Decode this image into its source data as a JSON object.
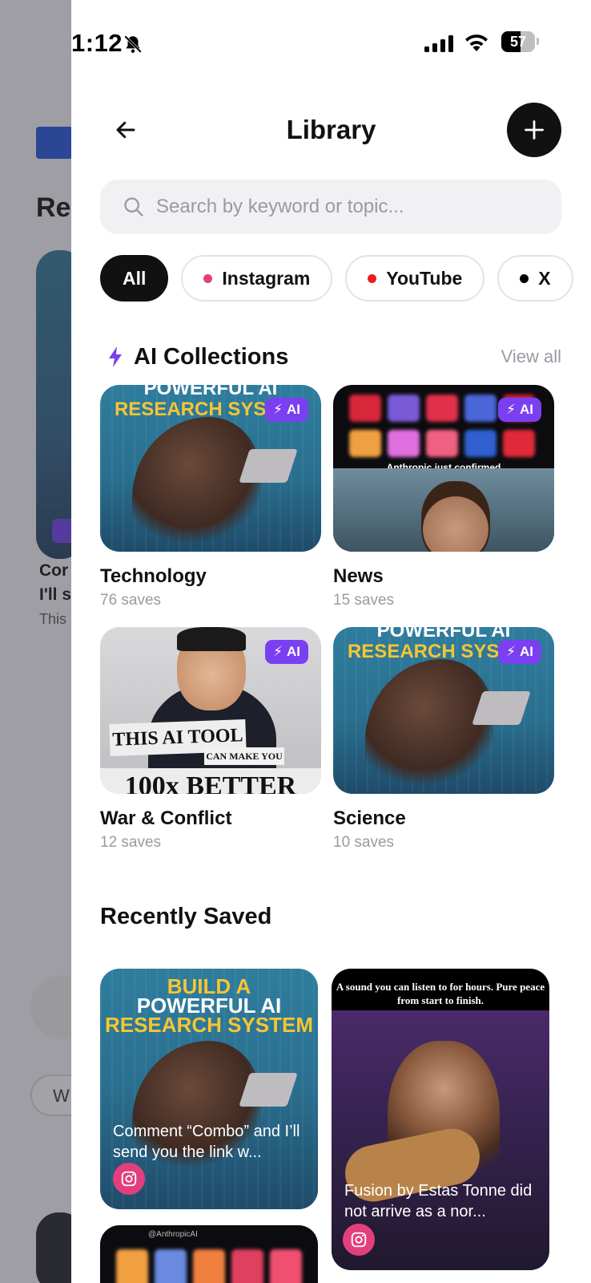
{
  "status_bar": {
    "time": "1:12",
    "battery": "57",
    "battery_level": 0.57
  },
  "background": {
    "title_fragment": "Re",
    "card_text_1": "Cor",
    "card_text_2": "I'll s",
    "card_text_3": "This",
    "pill_text": "W"
  },
  "header": {
    "title": "Library"
  },
  "search": {
    "placeholder": "Search by keyword or topic...",
    "value": ""
  },
  "filters": [
    {
      "label": "All",
      "active": true
    },
    {
      "label": "Instagram",
      "dot_color": "#e23f7d"
    },
    {
      "label": "YouTube",
      "dot_color": "#ee1d1d"
    },
    {
      "label": "X",
      "dot_color": "#000000"
    }
  ],
  "ai_collections": {
    "title": "AI Collections",
    "view_all": "View all",
    "badge": "AI",
    "items": [
      {
        "name": "Technology",
        "count": "76 saves",
        "thumb_text_top": "POWERFUL AI",
        "thumb_text_bottom": "RESEARCH SYSTEM"
      },
      {
        "name": "News",
        "count": "15 saves",
        "thumb_caption": "Anthropic just confirmed"
      },
      {
        "name": "War & Conflict",
        "count": "12 saves",
        "thumb_text_1": "THIS AI TOOL",
        "thumb_text_2": "CAN MAKE YOU",
        "thumb_text_3": "100x BETTER"
      },
      {
        "name": "Science",
        "count": "10 saves",
        "thumb_text_top": "POWERFUL AI",
        "thumb_text_bottom": "RESEARCH SYSTEM"
      }
    ]
  },
  "recently_saved": {
    "title": "Recently Saved",
    "items": [
      {
        "headline_1": "BUILD A",
        "headline_2": "POWERFUL AI",
        "headline_3": "RESEARCH SYSTEM",
        "caption": "Comment “Combo” and I’ll send you the link w...",
        "platform_icon": "instagram-icon"
      },
      {
        "top_text": "A sound you can listen to for hours. Pure peace from start to finish.",
        "caption": "Fusion by Estas Tonne did not arrive as a nor...",
        "platform_icon": "instagram-icon"
      },
      {
        "handle": "@AnthropicAI"
      }
    ]
  },
  "colors": {
    "accent_ai": "#7b3ff2",
    "instagram": "#e23f7d",
    "youtube": "#ee1d1d"
  }
}
